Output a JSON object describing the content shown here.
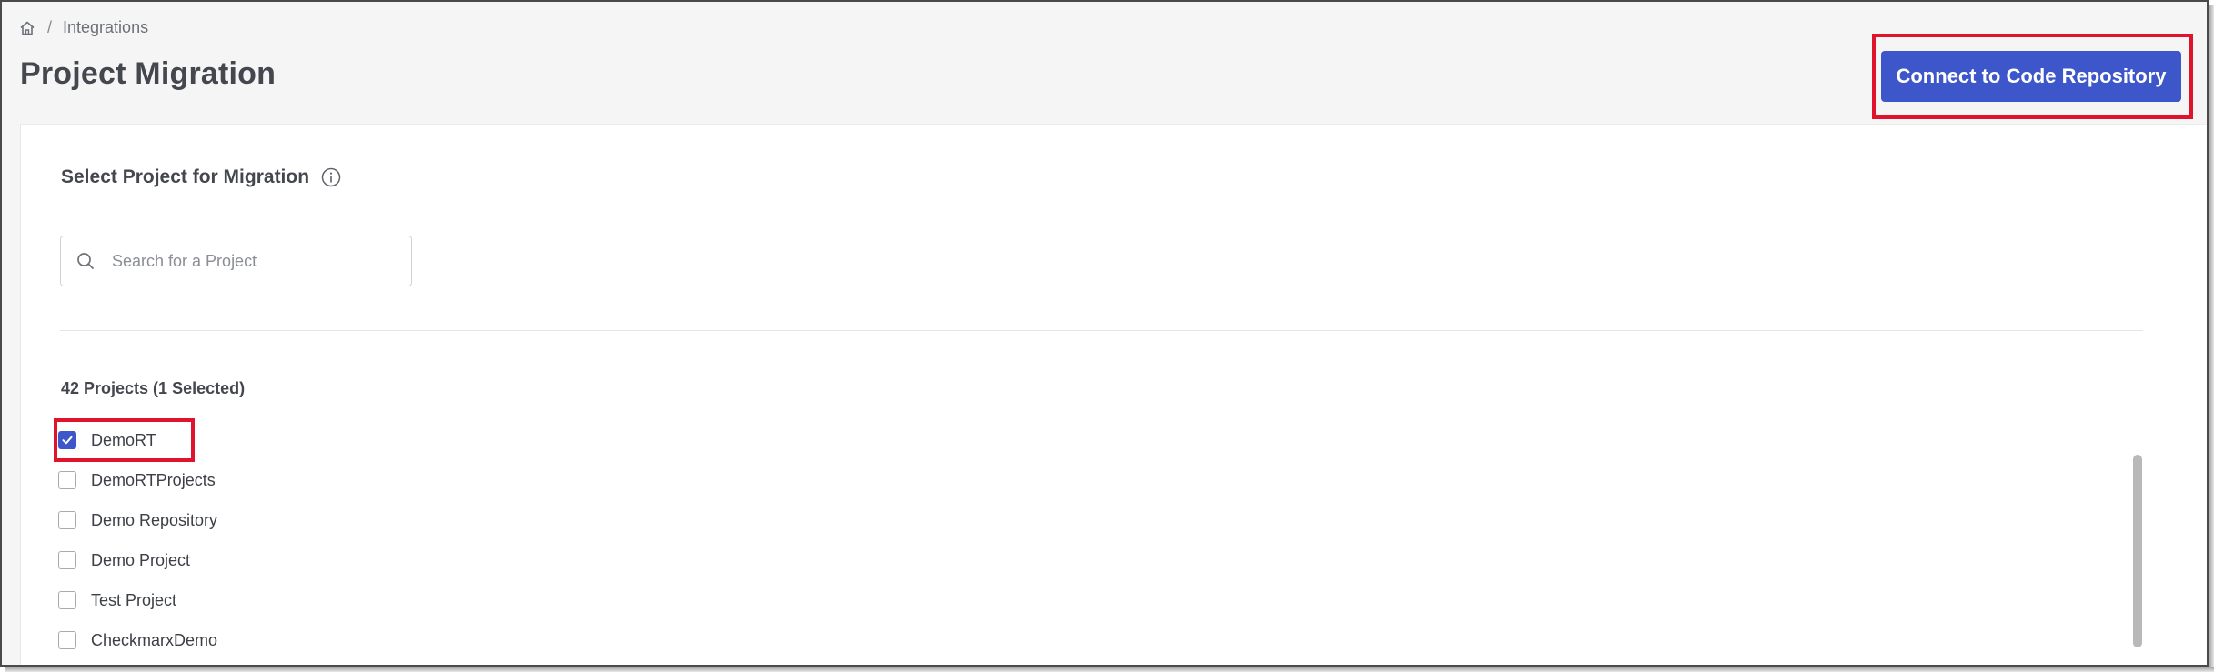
{
  "breadcrumb": {
    "home_icon": "home-icon",
    "separator": "/",
    "current": "Integrations"
  },
  "page_title": "Project Migration",
  "actions": {
    "connect_label": "Connect to Code Repository",
    "connect_color": "#3d56c9",
    "highlight_color": "#e0132d"
  },
  "selection": {
    "title": "Select Project for Migration",
    "info_icon": "info-icon",
    "search": {
      "placeholder": "Search for a Project",
      "value": ""
    },
    "count_label": "42 Projects (1 Selected)",
    "projects": [
      {
        "label": "DemoRT",
        "checked": true
      },
      {
        "label": "DemoRTProjects",
        "checked": false
      },
      {
        "label": "Demo Repository",
        "checked": false
      },
      {
        "label": "Demo Project",
        "checked": false
      },
      {
        "label": "Test Project",
        "checked": false
      },
      {
        "label": "CheckmarxDemo",
        "checked": false
      }
    ]
  }
}
